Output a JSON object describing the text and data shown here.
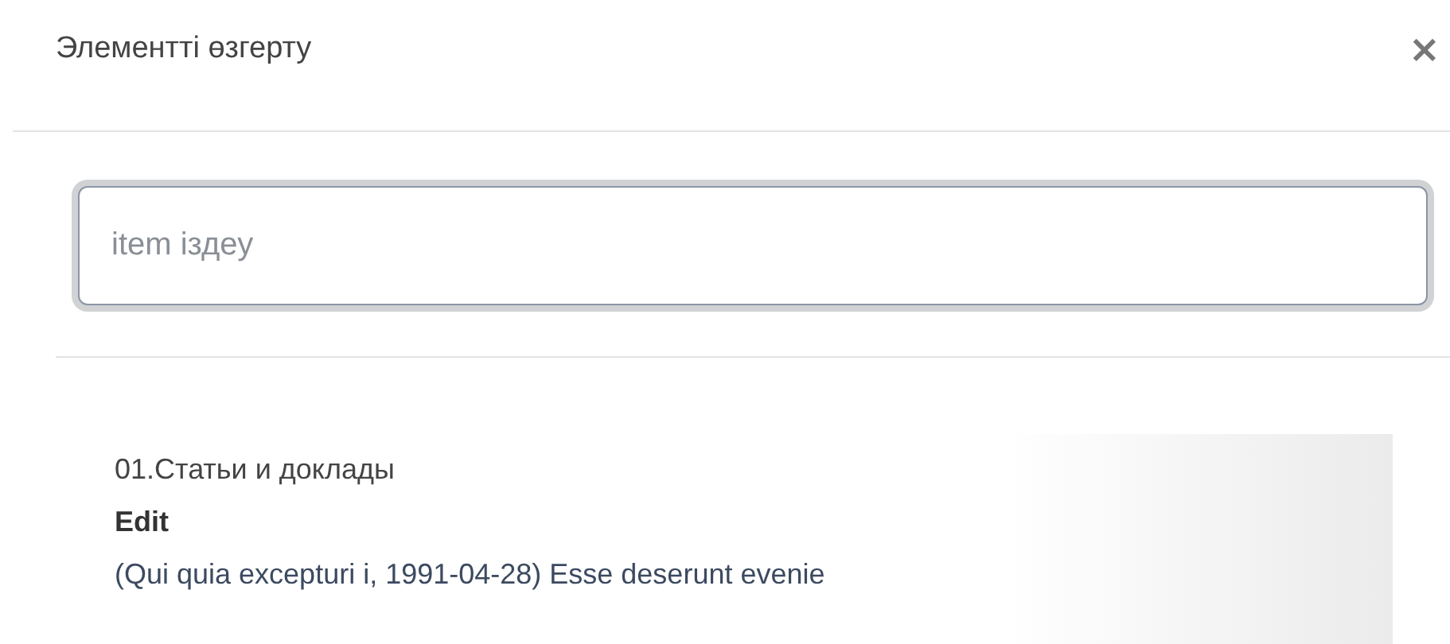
{
  "dialog": {
    "title": "Элементті өзгерту",
    "close": "×"
  },
  "search": {
    "placeholder": "item іздеу",
    "focused": true
  },
  "results": [
    {
      "category": "01.Статьи и доклады",
      "action": "Edit",
      "description": "(Qui quia excepturi i, 1991-04-28) Esse deserunt evenie"
    }
  ]
}
